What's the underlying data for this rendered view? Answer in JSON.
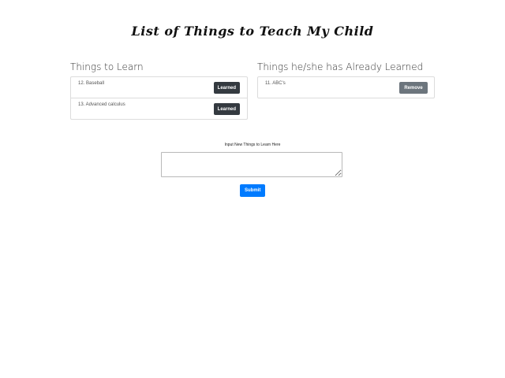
{
  "header": {
    "title": "List of Things to Teach My Child"
  },
  "to_learn": {
    "heading": "Things to Learn",
    "items": [
      {
        "text": "12. Baseball",
        "button_label": "Learned"
      },
      {
        "text": "13. Advanced calculus",
        "button_label": "Learned"
      }
    ]
  },
  "learned": {
    "heading": "Things he/she has Already Learned",
    "items": [
      {
        "text": "11. ABC's",
        "button_label": "Remove"
      }
    ]
  },
  "form": {
    "label": "Input New Things to Learn Here",
    "textarea_value": "",
    "submit_label": "Submit"
  },
  "colors": {
    "learned_button": "#343a40",
    "remove_button": "#6c757d",
    "submit_button": "#007bff"
  }
}
